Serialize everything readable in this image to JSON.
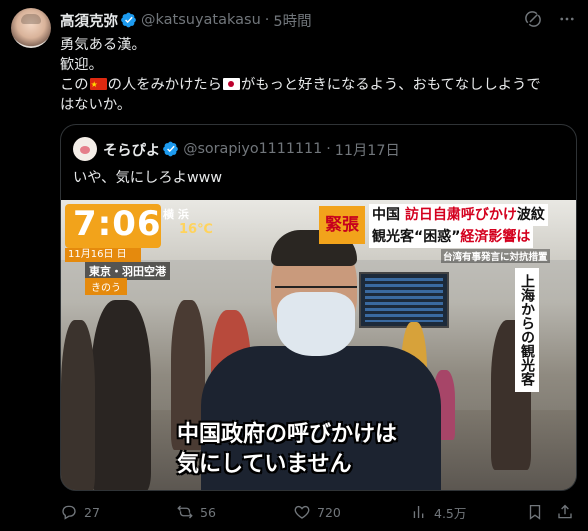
{
  "author": {
    "display_name": "高須克弥",
    "handle": "@katsuyatakasu",
    "time": "5時間"
  },
  "tweet": {
    "line1": "勇気ある漢。",
    "line2": "歓迎。",
    "line3_a": "この",
    "line3_b": "の人をみかけたら",
    "line3_c": "がもっと好きになるよう、おもてなししようで",
    "line4": "はないか。",
    "flag_1": "china-flag",
    "flag_2": "japan-flag"
  },
  "quote": {
    "display_name": "そらぴよ",
    "handle": "@sorapiyo1111111",
    "date": "11月17日",
    "text": "いや、気にしろよwww",
    "media": {
      "clock_time": "7:06",
      "clock_date": "11月16日 日",
      "weather_city": "横 浜",
      "weather_temp": "16℃",
      "location": "東京・羽田空港",
      "when": "きのう",
      "urgent": "緊張",
      "headline_l1_a": "中国",
      "headline_l1_b": "訪日自粛呼びかけ",
      "headline_l1_c": "波紋",
      "headline_l2_a": "観光客“困惑”",
      "headline_l2_b": "経済影響は",
      "subhead": "台湾有事発言に対抗措置",
      "vertical_caption": "上海からの観光客",
      "subtitle_l1": "中国政府の呼びかけは",
      "subtitle_l2": "気にしていません"
    }
  },
  "metrics": {
    "replies": "27",
    "retweets": "56",
    "likes": "720",
    "views": "4.5万"
  },
  "colors": {
    "verified": "#1d9bf0",
    "muted": "#71767b",
    "text": "#e7e9ea",
    "border": "#2f3336"
  }
}
